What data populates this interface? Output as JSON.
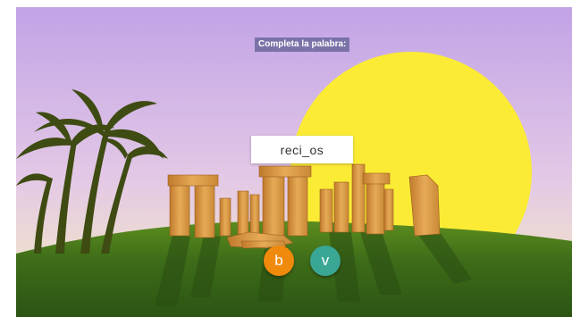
{
  "game": {
    "instruction": "Completa la palabra:",
    "word": "reci_os",
    "options": [
      {
        "label": "b",
        "color": "#f08a0c"
      },
      {
        "label": "v",
        "color": "#3aa795"
      }
    ]
  },
  "scene": {
    "sky_top": "#c1a3e6",
    "sky_bottom": "#f5e8bd",
    "sun": "#fbeb35",
    "hill": "#3a6a1a",
    "stone": "#d99a3c",
    "palm": "#3e4b12"
  }
}
